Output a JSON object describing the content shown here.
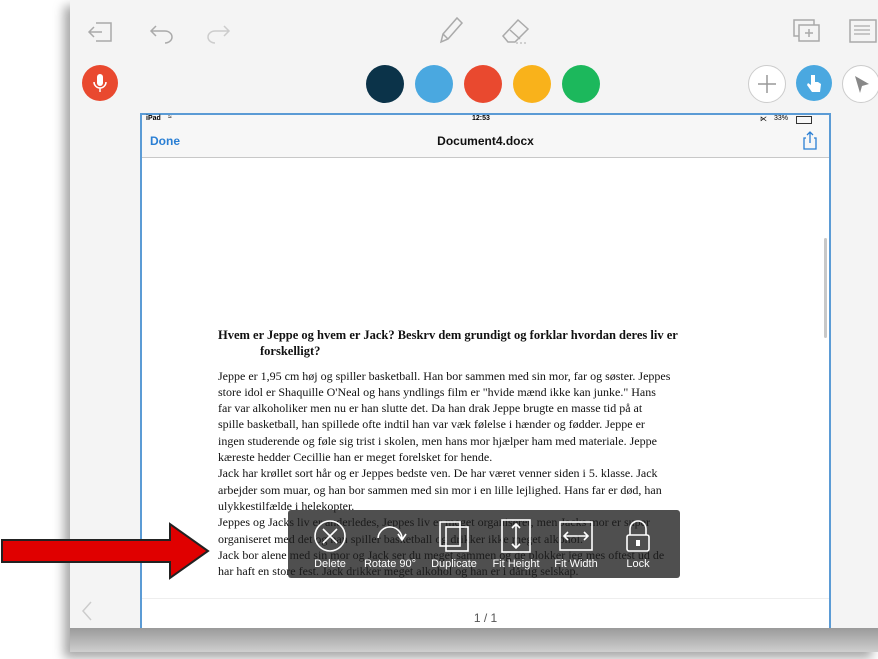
{
  "top_toolbar": {
    "icons": [
      "exit-icon",
      "undo-icon",
      "redo-icon",
      "pencil-icon",
      "eraser-icon",
      "add-page-icon",
      "document-list-icon"
    ]
  },
  "second_toolbar": {
    "mic_color": "#e9492f",
    "colors": [
      "#0b3349",
      "#4aa8e0",
      "#e9492f",
      "#f9b21b",
      "#1cb85c"
    ],
    "right_buttons": [
      "plus-icon",
      "hand-pointer-icon",
      "pointer-arrow-icon"
    ]
  },
  "ipad": {
    "status_left": "iPad",
    "time": "12:53",
    "battery": "33%",
    "done_label": "Done",
    "doc_title": "Document4.docx",
    "page_indicator": "1 / 1"
  },
  "document": {
    "heading_line1": "Hvem er Jeppe og hvem er Jack? Beskrv dem grundigt og forklar hvordan deres liv er",
    "heading_line2": "forskelligt?",
    "lines": [
      "Jeppe er 1,95 cm høj og spiller basketball. Han bor sammen med sin mor, far og søster. Jeppes",
      "store idol er Shaquille O'Neal og hans yndlings film er \"hvide mænd ikke kan junke.\" Hans",
      "far var alkoholiker men nu er han slutte det. Da han drak Jeppe brugte en masse tid på at",
      "spille basketball, han spillede ofte indtil han var væk følelse i hænder og fødder. Jeppe er",
      "ingen studerende og føle sig trist i skolen, men hans mor hjælper ham med materiale. Jeppe",
      "kæreste hedder Cecillie han er meget forelsket for hende.",
      "Jack har krøllet sort hår og er Jeppes bedste ven. De har været venner siden i 5. klasse. Jack",
      "arbejder som muar, og han bor sammen med sin mor i en lille lejlighed. Hans far er død, han",
      "ulykkestilfælde i helekopter.",
      "Jeppes og Jacks liv er anderledes, Jeppes liv er meget organiseret, men Jacks mor er super",
      "organiseret med det og han spiller basketball og drikker ikke meget alkohol.",
      "Jack bor alene med sin mor og Jack ser du meget sammen og de blokker jeg mes oftest ud de",
      "har haft  en store fest. Jack drikker meget alkohol og han er i dårlig selskap."
    ]
  },
  "popup_menu": {
    "items": [
      {
        "label": "Delete",
        "icon": "delete-circle-x-icon"
      },
      {
        "label": "Rotate 90°",
        "icon": "rotate-icon"
      },
      {
        "label": "Duplicate",
        "icon": "duplicate-icon"
      },
      {
        "label": "Fit Height",
        "icon": "fit-height-icon"
      },
      {
        "label": "Fit Width",
        "icon": "fit-width-icon"
      },
      {
        "label": "Lock",
        "icon": "lock-icon"
      }
    ]
  },
  "annotation_arrow_color": "#e00000"
}
